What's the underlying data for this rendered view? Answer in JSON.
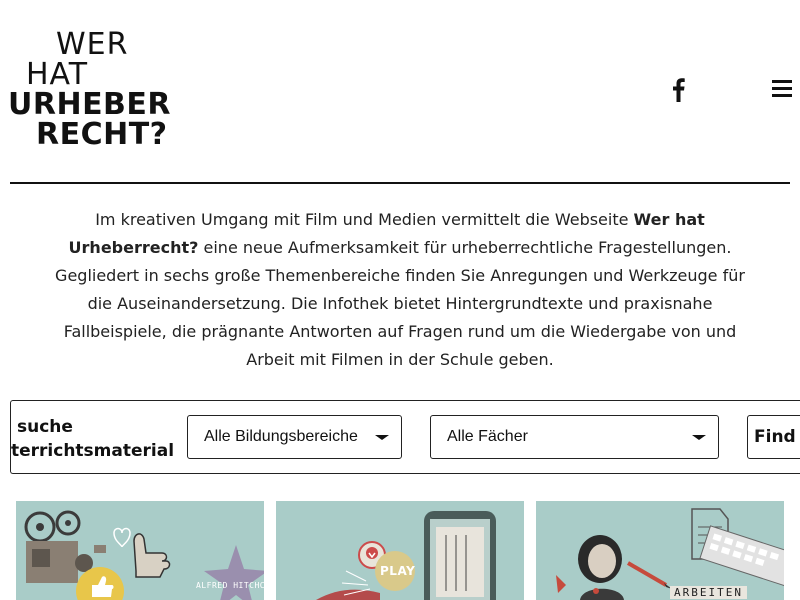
{
  "header": {
    "logo": {
      "line1": "WER",
      "line2": "HAT",
      "line3": "URHEBER",
      "line4": "RECHT?"
    },
    "facebook_icon": "facebook-icon",
    "menu_icon": "hamburger-menu-icon"
  },
  "intro": {
    "part1": "Im kreativen Umgang mit Film und Medien vermittelt die Webseite ",
    "bold1": "Wer hat Urheberrecht?",
    "part2": " eine neue Aufmerksamkeit für urheberrechtliche Fragestellungen. Gegliedert in sechs große Themenbereiche finden Sie Anregungen und Werkzeuge für die Auseinandersetzung. Die Infothek bietet Hintergrundtexte und praxisnahe Fallbeispiele, die prägnante Antworten auf Fragen rund um die Wiedergabe von und Arbeit mit Filmen in der Schule geben."
  },
  "search": {
    "label_line1": "suche",
    "label_line2": "terrichtsmaterial",
    "select_bildung": "Alle Bildungsbereiche",
    "select_faecher": "Alle Fächer",
    "find_label": "Find"
  },
  "cards": [
    {
      "star_label": "ALFRED HITCHCOCK"
    },
    {
      "badge_label": "PLAY"
    },
    {
      "stamp_label": "ARBEITEN"
    }
  ],
  "colors": {
    "card_background": "#a9ccc8",
    "text": "#1a1a1a",
    "badge_yellow": "#e8c64a",
    "play_badge": "#d9c98a"
  }
}
